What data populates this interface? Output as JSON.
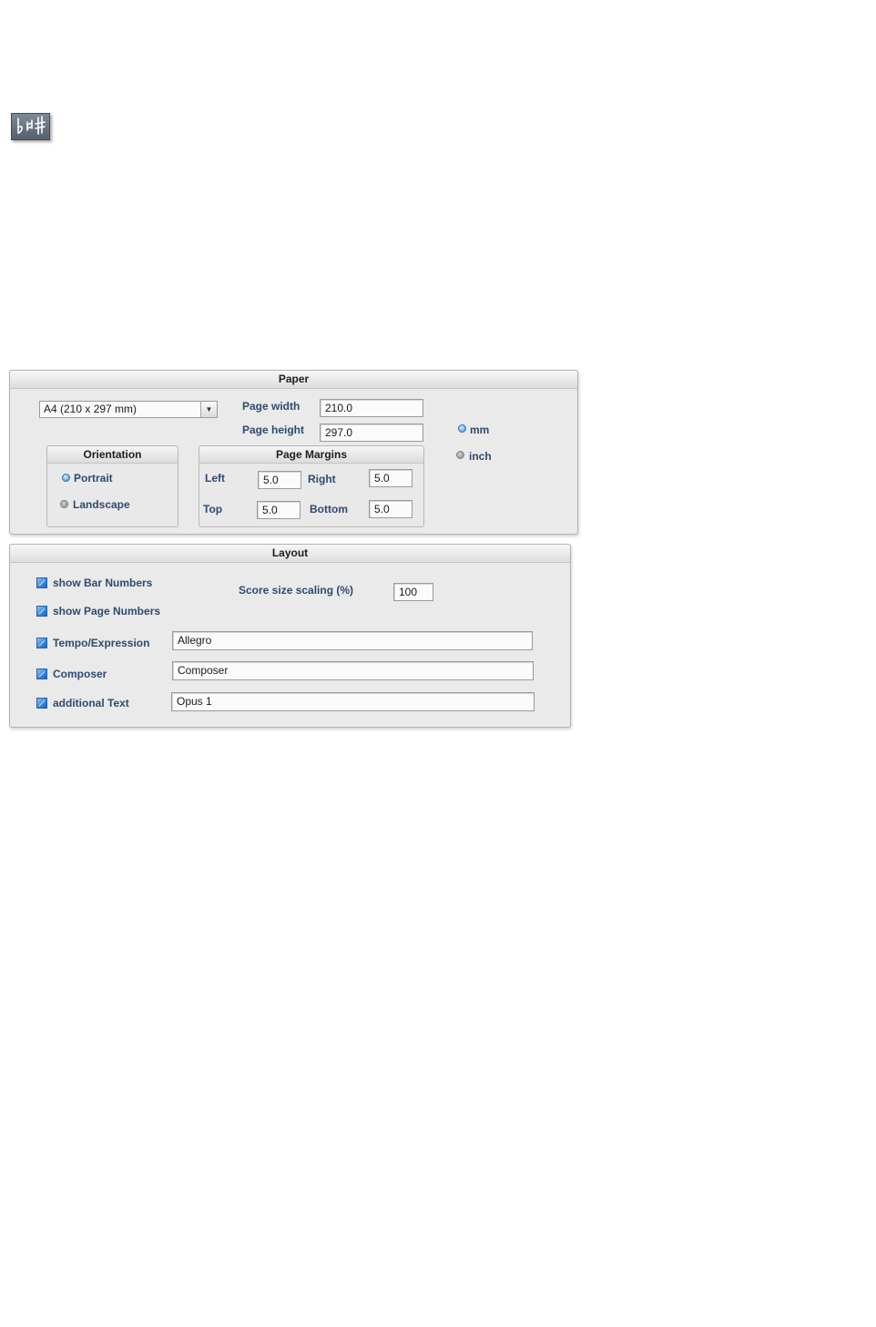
{
  "paper": {
    "title": "Paper",
    "paper_size": "A4 (210 x 297 mm)",
    "page_width_label": "Page width",
    "page_width_value": "210.0",
    "page_height_label": "Page height",
    "page_height_value": "297.0",
    "units": {
      "mm_label": "mm",
      "inch_label": "inch",
      "selected": "mm"
    },
    "orientation": {
      "title": "Orientation",
      "portrait_label": "Portrait",
      "landscape_label": "Landscape",
      "selected": "Portrait"
    },
    "margins": {
      "title": "Page Margins",
      "left_label": "Left",
      "left_value": "5.0",
      "right_label": "Right",
      "right_value": "5.0",
      "top_label": "Top",
      "top_value": "5.0",
      "bottom_label": "Bottom",
      "bottom_value": "5.0"
    }
  },
  "layout": {
    "title": "Layout",
    "show_bar_numbers_label": "show Bar Numbers",
    "show_page_numbers_label": "show Page Numbers",
    "score_scaling_label": "Score size scaling (%)",
    "score_scaling_value": "100",
    "tempo_label": "Tempo/Expression",
    "tempo_value": "Allegro",
    "composer_label": "Composer",
    "composer_value": "Composer",
    "additional_label": "additional Text",
    "additional_value": "Opus 1"
  },
  "icons": {
    "app": "flat-natural-sharp-icon"
  }
}
